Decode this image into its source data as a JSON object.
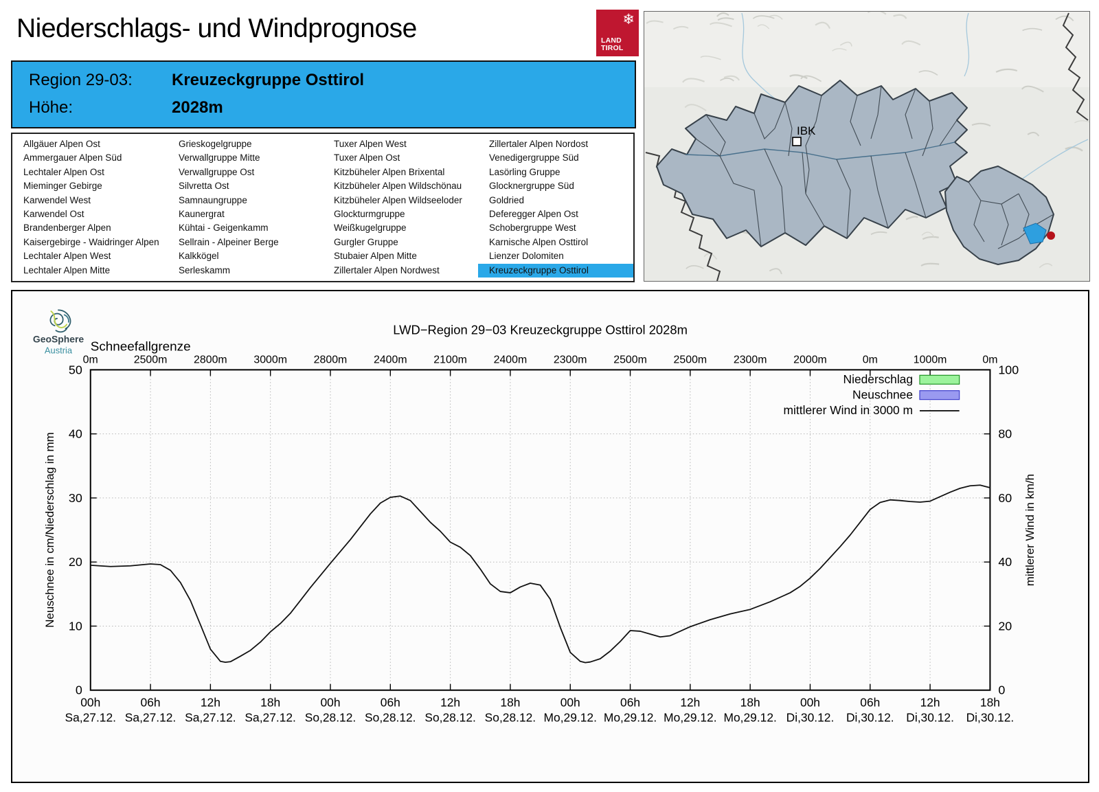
{
  "page": {
    "title": "Niederschlags- und Windprognose"
  },
  "land_tirol_logo": {
    "snowflake_icon": "❄",
    "line1": "LAND",
    "line2": "TIROL"
  },
  "region_header": {
    "region_label": "Region 29-03:",
    "region_name": "Kreuzeckgruppe Osttirol",
    "altitude_label": "Höhe:",
    "altitude_value": "2028m"
  },
  "region_list": {
    "selected": "Kreuzeckgruppe Osttirol",
    "columns": [
      [
        "Allgäuer Alpen Ost",
        "Ammergauer Alpen Süd",
        "Lechtaler Alpen Ost",
        "Mieminger Gebirge",
        "Karwendel West",
        "Karwendel Ost",
        "Brandenberger Alpen",
        "Kaisergebirge - Waidringer Alpen",
        "Lechtaler Alpen West",
        "Lechtaler Alpen Mitte"
      ],
      [
        "Grieskogelgruppe",
        "Verwallgruppe Mitte",
        "Verwallgruppe Ost",
        "Silvretta Ost",
        "Samnaungruppe",
        "Kaunergrat",
        "Kühtai - Geigenkamm",
        "Sellrain - Alpeiner Berge",
        "Kalkkögel",
        "Serleskamm"
      ],
      [
        "Tuxer Alpen West",
        "Tuxer Alpen Ost",
        "Kitzbüheler Alpen Brixental",
        "Kitzbüheler Alpen Wildschönau",
        "Kitzbüheler Alpen Wildseeloder",
        "Glockturmgruppe",
        "Weißkugelgruppe",
        "Gurgler Gruppe",
        "Stubaier Alpen Mitte",
        "Zillertaler Alpen Nordwest"
      ],
      [
        "Zillertaler Alpen Nordost",
        "Venedigergruppe Süd",
        "Lasörling Gruppe",
        "Glocknergruppe Süd",
        "Goldried",
        "Deferegger Alpen Ost",
        "Schobergruppe West",
        "Karnische Alpen Osttirol",
        "Lienzer Dolomiten",
        "Kreuzeckgruppe Osttirol"
      ]
    ]
  },
  "map": {
    "city_label": "IBK"
  },
  "geosphere_logo": {
    "name": "GeoSphere",
    "country": "Austria"
  },
  "colors": {
    "accent_blue": "#2aa8e8",
    "logo_red": "#bf1730",
    "map_region_fill": "#aab7c4",
    "map_region_border": "#37414a",
    "selected_region_fill": "#2e9fdf",
    "marker_red": "#b5121b"
  },
  "chart_data": {
    "type": "line",
    "title": "LWD−Region 29−03 Kreuzeckgruppe Osttirol 2028m",
    "snowline_label": "Schneefallgrenze",
    "snowline_values": [
      "0m",
      "2500m",
      "2800m",
      "3000m",
      "2800m",
      "2400m",
      "2100m",
      "2400m",
      "2300m",
      "2500m",
      "2500m",
      "2300m",
      "2000m",
      "0m",
      "1000m",
      "0m"
    ],
    "x_tick_hours": [
      "00h",
      "06h",
      "12h",
      "18h",
      "00h",
      "06h",
      "12h",
      "18h",
      "00h",
      "06h",
      "12h",
      "18h",
      "00h",
      "06h",
      "12h",
      "18h"
    ],
    "x_tick_days": [
      "Sa,27.12.",
      "Sa,27.12.",
      "Sa,27.12.",
      "Sa,27.12.",
      "So,28.12.",
      "So,28.12.",
      "So,28.12.",
      "So,28.12.",
      "Mo,29.12.",
      "Mo,29.12.",
      "Mo,29.12.",
      "Mo,29.12.",
      "Di,30.12.",
      "Di,30.12.",
      "Di,30.12.",
      "Di,30.12."
    ],
    "x_range_hours": [
      0,
      90
    ],
    "ylabel_left": "Neuschnee in cm/Niederschlag in mm",
    "ylabel_right": "mittlerer Wind in km/h",
    "ylim_left": [
      0,
      50
    ],
    "ylim_right": [
      0,
      100
    ],
    "yticks_left": [
      0,
      10,
      20,
      30,
      40,
      50
    ],
    "yticks_right": [
      0,
      20,
      40,
      60,
      80,
      100
    ],
    "grid": true,
    "legend_position": "top-right-inside",
    "legend": [
      {
        "label": "Niederschlag",
        "swatch": "box",
        "fill": "#9cf39c",
        "border": "#1f9323"
      },
      {
        "label": "Neuschnee",
        "swatch": "box",
        "fill": "#9a9af0",
        "border": "#3c3ccc"
      },
      {
        "label": "mittlerer Wind in 3000 m",
        "swatch": "line",
        "color": "#000000"
      }
    ],
    "series": [
      {
        "name": "Niederschlag",
        "type": "bars",
        "axis": "left",
        "unit": "mm",
        "values": []
      },
      {
        "name": "Neuschnee",
        "type": "bars",
        "axis": "left",
        "unit": "cm",
        "values": []
      },
      {
        "name": "mittlerer Wind in 3000 m",
        "type": "line",
        "axis": "right",
        "unit": "km/h",
        "x_hours": [
          0,
          2,
          4,
          6,
          7,
          8,
          9,
          10,
          11,
          12,
          13,
          13.5,
          14,
          15,
          16,
          17,
          18,
          19,
          20,
          21,
          22,
          24,
          26,
          28,
          29,
          30,
          31,
          32,
          33,
          34,
          35,
          36,
          37,
          38,
          39,
          40,
          41,
          42,
          43,
          44,
          45,
          46,
          47,
          48,
          49,
          49.5,
          50,
          51,
          52,
          53,
          54,
          55,
          56,
          57,
          58,
          59,
          60,
          62,
          64,
          66,
          68,
          70,
          71,
          72,
          73,
          74,
          75,
          76,
          77,
          78,
          79,
          80,
          81,
          82,
          83,
          84,
          85,
          86,
          87,
          88,
          89,
          90
        ],
        "values": [
          39.0,
          38.6,
          38.8,
          39.4,
          39.2,
          37.4,
          33.6,
          28.0,
          20.4,
          12.8,
          9.0,
          8.7,
          8.9,
          10.6,
          12.4,
          15.0,
          18.2,
          20.8,
          24.0,
          28.0,
          32.0,
          39.6,
          47.0,
          55.0,
          58.4,
          60.2,
          60.6,
          59.2,
          55.8,
          52.4,
          49.6,
          46.2,
          44.6,
          42.0,
          37.8,
          33.2,
          30.8,
          30.4,
          32.2,
          33.4,
          32.8,
          28.4,
          19.6,
          11.8,
          9.0,
          8.6,
          8.8,
          9.8,
          12.2,
          15.2,
          18.6,
          18.4,
          17.5,
          16.6,
          17.0,
          18.4,
          19.8,
          22.0,
          23.8,
          25.2,
          27.6,
          30.4,
          32.4,
          35.0,
          38.0,
          41.4,
          44.8,
          48.4,
          52.4,
          56.4,
          58.6,
          59.4,
          59.2,
          58.9,
          58.7,
          59.0,
          60.4,
          61.8,
          63.0,
          63.8,
          64.0,
          63.2
        ]
      }
    ]
  }
}
